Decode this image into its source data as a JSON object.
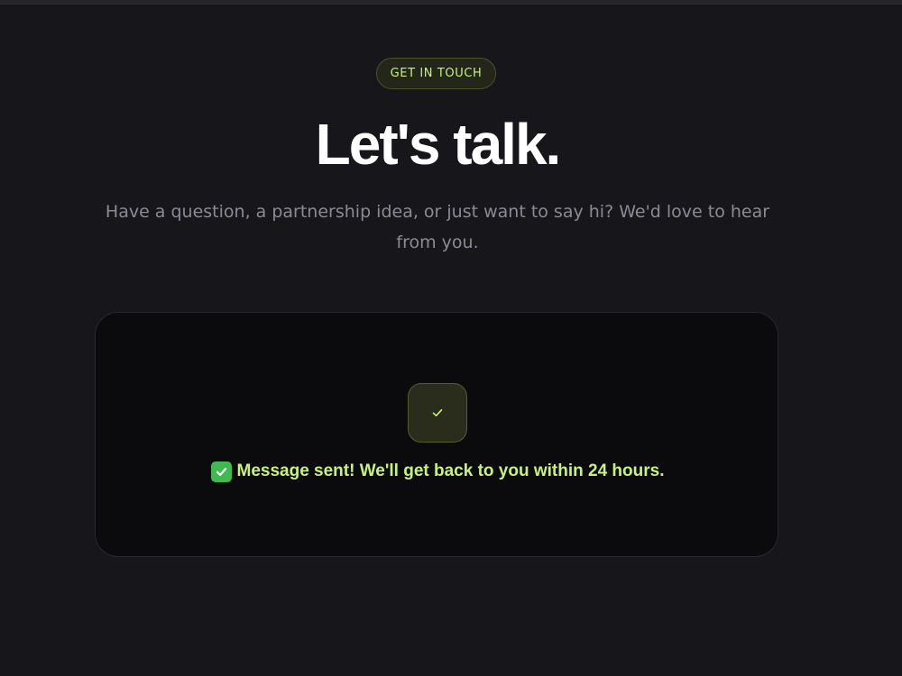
{
  "badge": {
    "label": "GET IN TOUCH"
  },
  "hero": {
    "title": "Let's talk.",
    "subtitle": "Have a question, a partnership idea, or just want to say hi? We'd love to hear from you."
  },
  "success": {
    "icon": "check-icon",
    "message": "Message sent! We'll get back to you within 24 hours."
  },
  "colors": {
    "accent": "#c8f27a",
    "background": "#17161b",
    "card": "#0b0b0d",
    "success_emoji": "#3fb950"
  }
}
